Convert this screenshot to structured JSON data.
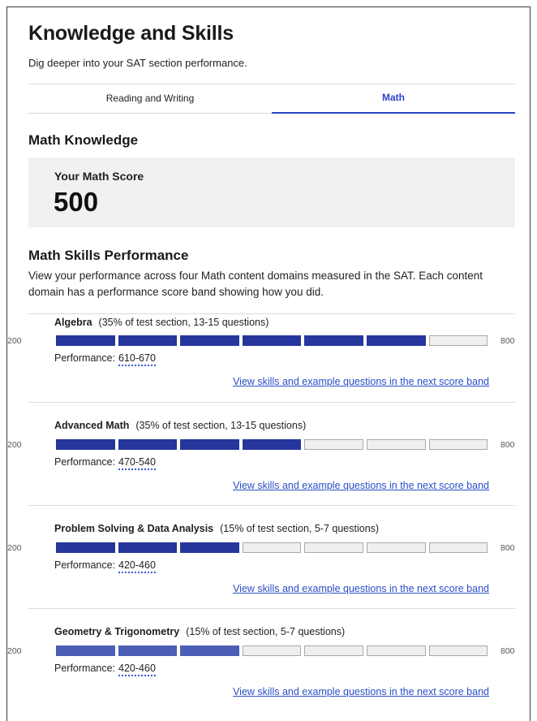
{
  "page": {
    "title": "Knowledge and Skills",
    "subtitle": "Dig deeper into your SAT section performance."
  },
  "tabs": [
    {
      "label": "Reading and Writing",
      "active": false
    },
    {
      "label": "Math",
      "active": true
    }
  ],
  "knowledge": {
    "heading": "Math Knowledge",
    "score_label": "Your Math Score",
    "score_value": "500"
  },
  "skills": {
    "heading": "Math Skills Performance",
    "description": "View your performance across four Math content domains measured in the SAT. Each content domain has a performance score band showing how you did.",
    "scale_min": "200",
    "scale_max": "800",
    "perf_label": "Performance:",
    "link_label": "View skills and example questions in the next score band",
    "total_bands": 7,
    "domains": [
      {
        "name": "Algebra",
        "meta": "(35% of test section, 13-15 questions)",
        "range": "610-670",
        "filled": 6
      },
      {
        "name": "Advanced Math",
        "meta": "(35% of test section, 13-15 questions)",
        "range": "470-540",
        "filled": 4
      },
      {
        "name": "Problem Solving & Data Analysis",
        "meta": "(15% of test section, 5-7 questions)",
        "range": "420-460",
        "filled": 3
      },
      {
        "name": "Geometry & Trigonometry",
        "meta": "(15% of test section, 5-7 questions)",
        "range": "420-460",
        "filled": 3
      }
    ]
  },
  "colors": {
    "accent": "#2b44c5",
    "bar_filled": "#26369c",
    "bar_filled_light": "#4c5eb5",
    "bar_empty": "#efefef",
    "link": "#2b4ec7"
  }
}
